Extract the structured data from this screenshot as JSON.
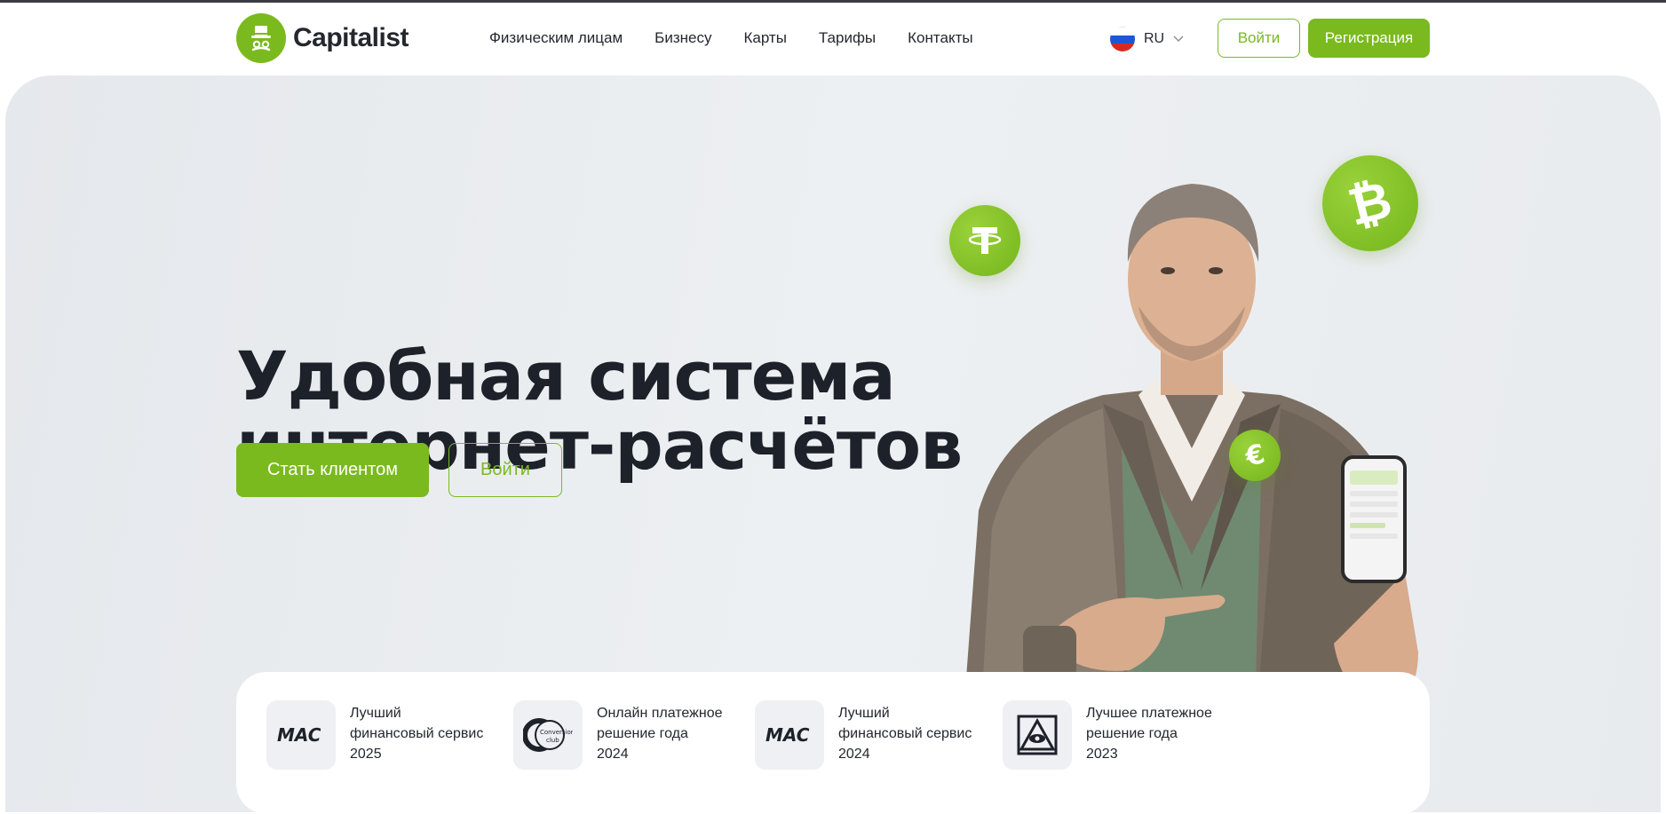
{
  "brand": {
    "name": "Capitalist",
    "accent": "#7aba1e"
  },
  "nav": {
    "items": [
      {
        "label": "Физическим лицам"
      },
      {
        "label": "Бизнесу"
      },
      {
        "label": "Карты"
      },
      {
        "label": "Тарифы"
      },
      {
        "label": "Контакты"
      }
    ]
  },
  "header": {
    "language": "RU",
    "login_label": "Войти",
    "register_label": "Регистрация"
  },
  "hero": {
    "title_line1": "Удобная система",
    "title_line2": "интернет-расчётов",
    "cta_primary": "Стать клиентом",
    "cta_secondary": "Войти"
  },
  "awards": [
    {
      "icon": "mac-logo",
      "line1": "Лучший",
      "line2": "финансовый сервис",
      "line3": "2025"
    },
    {
      "icon": "conversion-club-logo",
      "line1": "Онлайн платежное",
      "line2": "решение года",
      "line3": "2024"
    },
    {
      "icon": "mac-logo",
      "line1": "Лучший",
      "line2": "финансовый сервис",
      "line3": "2024"
    },
    {
      "icon": "eye-pyramid-logo",
      "line1": "Лучшее платежное",
      "line2": "решение года",
      "line3": "2023"
    }
  ],
  "icons": [
    "tether-icon",
    "bitcoin-icon",
    "euro-icon",
    "chevron-down-icon",
    "russia-flag-icon"
  ]
}
